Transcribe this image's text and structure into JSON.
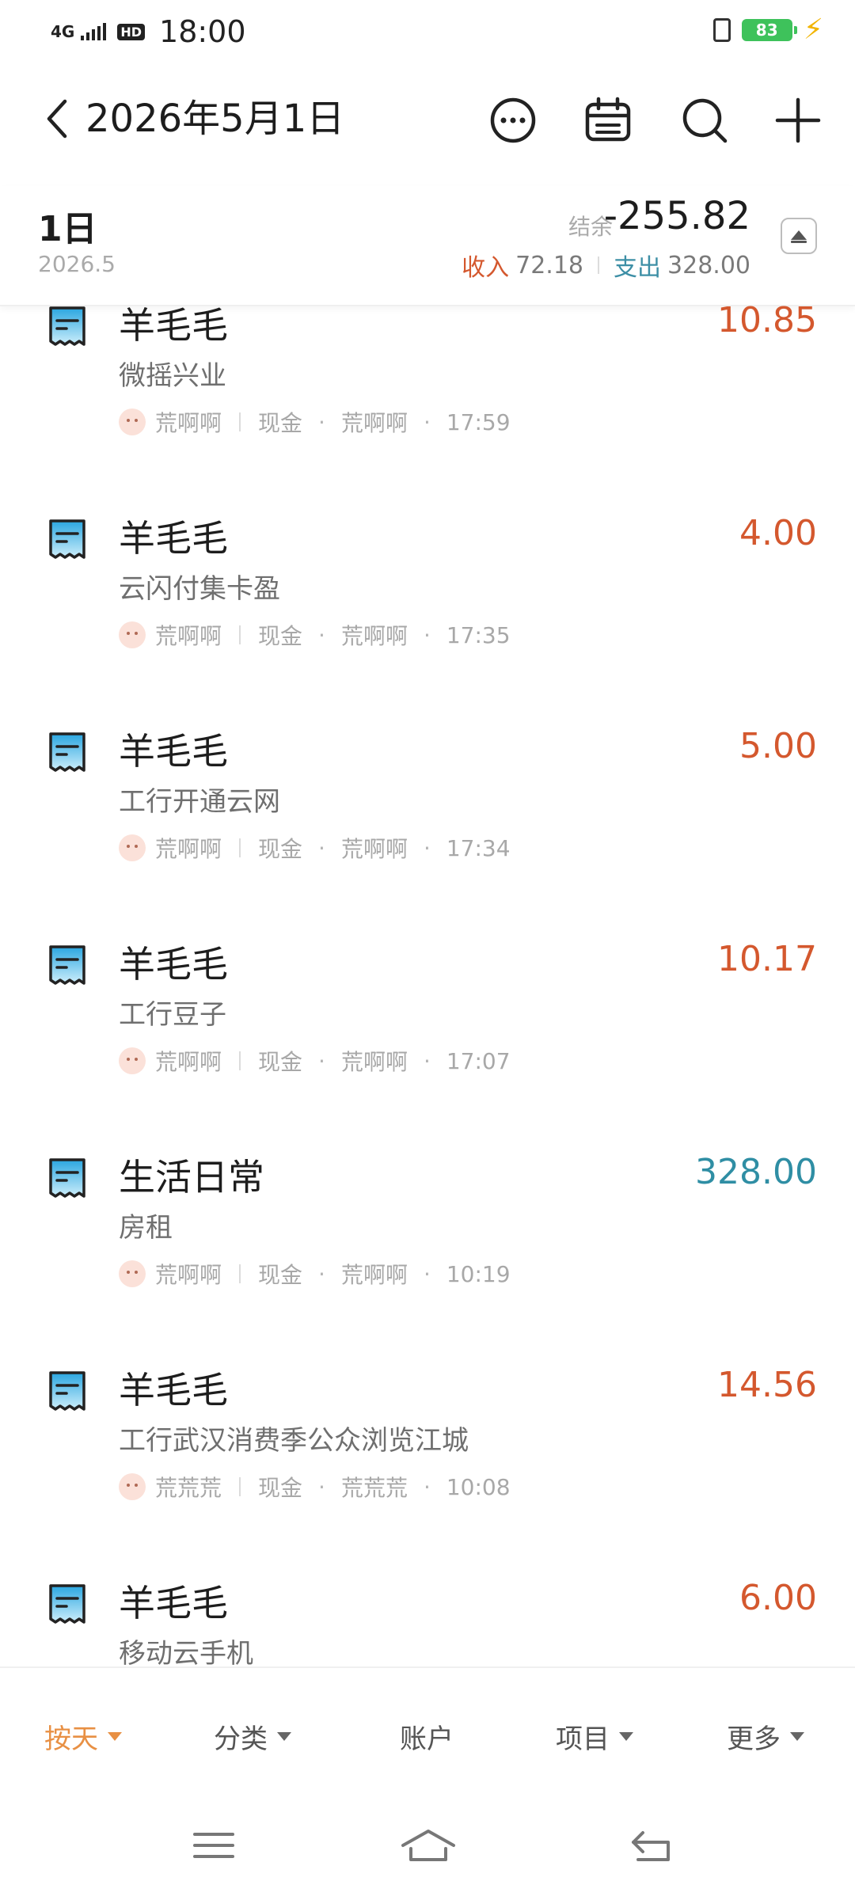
{
  "status_bar": {
    "network": "4G",
    "hd_badge": "HD",
    "time": "18:00",
    "battery": "83"
  },
  "header": {
    "title": "2026年5月1日"
  },
  "summary": {
    "day": "1日",
    "year_month": "2026.5",
    "balance_label": "结余",
    "balance_value": "-255.82",
    "income_label": "收入",
    "income_value": "72.18",
    "expense_label": "支出",
    "expense_value": "328.00"
  },
  "colors": {
    "income_accent": "#d4582e",
    "expense_accent": "#2f8ea4",
    "tab_active": "#e89044"
  },
  "transactions": [
    {
      "category": "羊毛毛",
      "note": "微摇兴业",
      "amount": "10.85",
      "kind": "income",
      "member": "荒啊啊",
      "account": "现金",
      "book": "荒啊啊",
      "time": "17:59"
    },
    {
      "category": "羊毛毛",
      "note": "云闪付集卡盈",
      "amount": "4.00",
      "kind": "income",
      "member": "荒啊啊",
      "account": "现金",
      "book": "荒啊啊",
      "time": "17:35"
    },
    {
      "category": "羊毛毛",
      "note": "工行开通云网",
      "amount": "5.00",
      "kind": "income",
      "member": "荒啊啊",
      "account": "现金",
      "book": "荒啊啊",
      "time": "17:34"
    },
    {
      "category": "羊毛毛",
      "note": "工行豆子",
      "amount": "10.17",
      "kind": "income",
      "member": "荒啊啊",
      "account": "现金",
      "book": "荒啊啊",
      "time": "17:07"
    },
    {
      "category": "生活日常",
      "note": "房租",
      "amount": "328.00",
      "kind": "expense",
      "member": "荒啊啊",
      "account": "现金",
      "book": "荒啊啊",
      "time": "10:19"
    },
    {
      "category": "羊毛毛",
      "note": "工行武汉消费季公众浏览江城",
      "amount": "14.56",
      "kind": "income",
      "member": "荒荒荒",
      "account": "现金",
      "book": "荒荒荒",
      "time": "10:08"
    },
    {
      "category": "羊毛毛",
      "note": "移动云手机",
      "amount": "6.00",
      "kind": "income",
      "member": "",
      "account": "",
      "book": "",
      "time": ""
    }
  ],
  "tabs": [
    {
      "label": "按天",
      "active": true,
      "dropdown": true
    },
    {
      "label": "分类",
      "active": false,
      "dropdown": true
    },
    {
      "label": "账户",
      "active": false,
      "dropdown": false
    },
    {
      "label": "项目",
      "active": false,
      "dropdown": true
    },
    {
      "label": "更多",
      "active": false,
      "dropdown": true
    }
  ],
  "icons": {
    "back": "chevron-left-icon",
    "more": "more-horizontal-icon",
    "calendar": "calendar-icon",
    "search": "search-icon",
    "add": "plus-icon",
    "collapse": "collapse-up-icon",
    "transaction": "receipt-icon",
    "nav_menu": "menu-icon",
    "nav_home": "home-icon",
    "nav_back": "back-arrow-icon"
  }
}
